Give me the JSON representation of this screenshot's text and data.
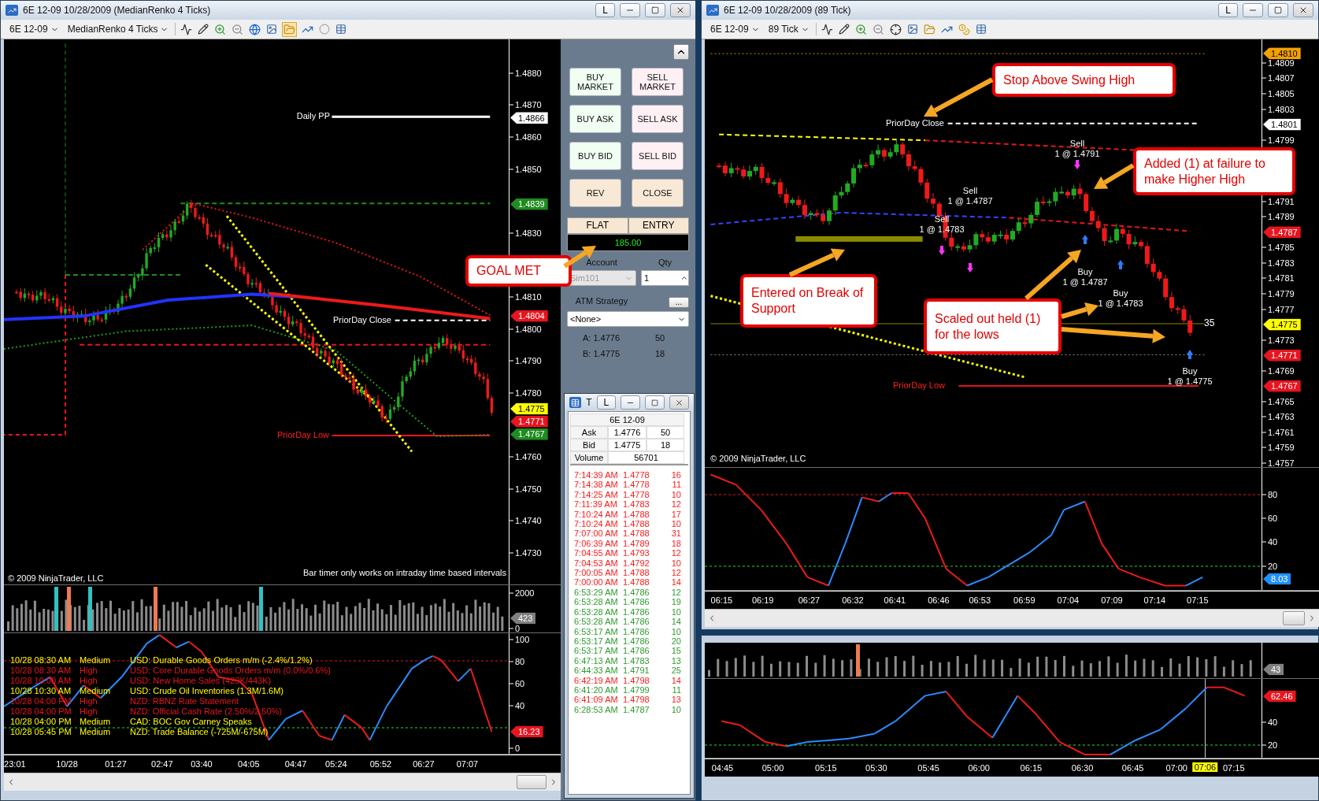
{
  "left_window": {
    "title": "6E 12-09  10/28/2009 (MedianRenko 4 Ticks)",
    "pin": "L",
    "toolbar": {
      "instrument": "6E 12-09",
      "period": "MedianRenko 4 Ticks"
    },
    "price_chart": {
      "daily_pp": "Daily PP",
      "prior_close": "PriorDay Close",
      "prior_low": "PriorDay Low",
      "copyright": "© 2009 NinjaTrader, LLC",
      "bar_timer_note": "Bar timer only works on intraday time based intervals",
      "axis": [
        "1.4880",
        "1.4870",
        "1.4860",
        "1.4850",
        "1.4830",
        "1.4810",
        "1.4800",
        "1.4790",
        "1.4780",
        "1.4760",
        "1.4750",
        "1.4740",
        "1.4730"
      ],
      "tags": [
        {
          "text": "1.4866",
          "color": "#ffffff"
        },
        {
          "text": "1.4839",
          "color": "#1e8c1e"
        },
        {
          "text": "1.4804",
          "color": "#e8141e"
        },
        {
          "text": "1.4775",
          "color": "#ffff00"
        },
        {
          "text": "1.4771",
          "color": "#e8141e"
        },
        {
          "text": "1.4767",
          "color": "#1e8c1e"
        }
      ],
      "callout": "GOAL MET"
    },
    "volume": {
      "axis": [
        "2000",
        "0"
      ],
      "tag": {
        "text": "423",
        "color": "#808080"
      }
    },
    "oscillator": {
      "axis": [
        "100",
        "80",
        "60",
        "40",
        "0"
      ],
      "tag": {
        "text": "16.23",
        "color": "#e8141e"
      },
      "news": [
        {
          "time": "10/28 08:30 AM",
          "impact": "Medium",
          "text": "USD: Durable Goods Orders m/m (-2.4%/1.2%)",
          "color": "#ffff00"
        },
        {
          "time": "10/28 08:30 AM",
          "impact": "High",
          "text": "USD: Core Durable Goods Orders m/m (0.0%/0.6%)",
          "color": "#e8141e"
        },
        {
          "time": "10/28 10:00 AM",
          "impact": "High",
          "text": "USD: New Home Sales (429K/443K)",
          "color": "#e8141e"
        },
        {
          "time": "10/28 10:30 AM",
          "impact": "Medium",
          "text": "USD: Crude Oil Inventories (1.3M/1.6M)",
          "color": "#ffff00"
        },
        {
          "time": "10/28 04:00 PM",
          "impact": "High",
          "text": "NZD: RBNZ Rate Statement",
          "color": "#e8141e"
        },
        {
          "time": "10/28 04:00 PM",
          "impact": "High",
          "text": "NZD: Official Cash Rate (2.50%/2.50%)",
          "color": "#e8141e"
        },
        {
          "time": "10/28 04:00 PM",
          "impact": "Medium",
          "text": "CAD: BOC Gov Carney Speaks",
          "color": "#ffff00"
        },
        {
          "time": "10/28 05:45 PM",
          "impact": "Medium",
          "text": "NZD: Trade Balance (-725M/-675M)",
          "color": "#ffff00"
        }
      ]
    },
    "x_axis": [
      "23:01",
      "10/28",
      "01:27",
      "02:47",
      "03:40",
      "04:05",
      "04:47",
      "05:24",
      "05:52",
      "06:27",
      "07:07"
    ]
  },
  "order_panel": {
    "buttons": [
      {
        "label": "BUY MARKET",
        "kind": "buy"
      },
      {
        "label": "SELL MARKET",
        "kind": "sell"
      },
      {
        "label": "BUY ASK",
        "kind": "buy"
      },
      {
        "label": "SELL ASK",
        "kind": "sell"
      },
      {
        "label": "BUY BID",
        "kind": "buy"
      },
      {
        "label": "SELL BID",
        "kind": "sell"
      },
      {
        "label": "REV",
        "kind": "neutral"
      },
      {
        "label": "CLOSE",
        "kind": "neutral"
      }
    ],
    "position": {
      "status": "FLAT",
      "entry": "ENTRY",
      "pnl": "185.00"
    },
    "account": {
      "label": "Account",
      "value": "Sim101",
      "disabled": true
    },
    "qty": {
      "label": "Qty",
      "value": "1"
    },
    "atm": {
      "label": "ATM Strategy",
      "button": "...",
      "value": "<None>"
    },
    "quote": [
      {
        "label": "A: 1.4776",
        "size": "50"
      },
      {
        "label": "B: 1.4775",
        "size": "18"
      }
    ]
  },
  "time_sales": {
    "title": "T",
    "pin": "L",
    "instrument": "6E 12-09",
    "quote": [
      {
        "label": "Ask",
        "price": "1.4776",
        "size": "50"
      },
      {
        "label": "Bid",
        "price": "1.4775",
        "size": "18"
      }
    ],
    "volume_label": "Volume",
    "volume": "56701",
    "trades": [
      {
        "time": "7:14:39 AM",
        "price": "1.4778",
        "size": "16",
        "color": "#ff1a1a"
      },
      {
        "time": "7:14:38 AM",
        "price": "1.4778",
        "size": "11",
        "color": "#ff1a1a"
      },
      {
        "time": "7:14:25 AM",
        "price": "1.4778",
        "size": "10",
        "color": "#ff1a1a"
      },
      {
        "time": "7:11:39 AM",
        "price": "1.4783",
        "size": "12",
        "color": "#ff1a1a"
      },
      {
        "time": "7:10:24 AM",
        "price": "1.4788",
        "size": "17",
        "color": "#ff1a1a"
      },
      {
        "time": "7:10:24 AM",
        "price": "1.4788",
        "size": "10",
        "color": "#ff1a1a"
      },
      {
        "time": "7:07:00 AM",
        "price": "1.4788",
        "size": "31",
        "color": "#ff1a1a"
      },
      {
        "time": "7:06:39 AM",
        "price": "1.4789",
        "size": "18",
        "color": "#ff1a1a"
      },
      {
        "time": "7:04:55 AM",
        "price": "1.4793",
        "size": "12",
        "color": "#ff1a1a"
      },
      {
        "time": "7:04:53 AM",
        "price": "1.4792",
        "size": "10",
        "color": "#ff1a1a"
      },
      {
        "time": "7:00:05 AM",
        "price": "1.4788",
        "size": "12",
        "color": "#ff1a1a"
      },
      {
        "time": "7:00:00 AM",
        "price": "1.4788",
        "size": "14",
        "color": "#ff1a1a"
      },
      {
        "time": "6:53:29 AM",
        "price": "1.4786",
        "size": "12",
        "color": "#2e9a2e"
      },
      {
        "time": "6:53:28 AM",
        "price": "1.4786",
        "size": "19",
        "color": "#2e9a2e"
      },
      {
        "time": "6:53:28 AM",
        "price": "1.4786",
        "size": "10",
        "color": "#2e9a2e"
      },
      {
        "time": "6:53:28 AM",
        "price": "1.4786",
        "size": "14",
        "color": "#2e9a2e"
      },
      {
        "time": "6:53:17 AM",
        "price": "1.4786",
        "size": "10",
        "color": "#2e9a2e"
      },
      {
        "time": "6:53:17 AM",
        "price": "1.4786",
        "size": "20",
        "color": "#2e9a2e"
      },
      {
        "time": "6:53:17 AM",
        "price": "1.4786",
        "size": "15",
        "color": "#2e9a2e"
      },
      {
        "time": "6:47:13 AM",
        "price": "1.4783",
        "size": "13",
        "color": "#2e9a2e"
      },
      {
        "time": "6:44:33 AM",
        "price": "1.4791",
        "size": "25",
        "color": "#2e9a2e"
      },
      {
        "time": "6:42:19 AM",
        "price": "1.4798",
        "size": "14",
        "color": "#ff1a1a"
      },
      {
        "time": "6:41:20 AM",
        "price": "1.4799",
        "size": "11",
        "color": "#2e9a2e"
      },
      {
        "time": "6:41:09 AM",
        "price": "1.4798",
        "size": "13",
        "color": "#ff1a1a"
      },
      {
        "time": "6:28:53 AM",
        "price": "1.4787",
        "size": "10",
        "color": "#2e9a2e"
      }
    ]
  },
  "right_window": {
    "title": "6E 12-09  10/28/2009 (89 Tick)",
    "pin": "L",
    "toolbar": {
      "instrument": "6E 12-09",
      "period": "89 Tick"
    },
    "price_chart": {
      "prior_close": "PriorDay Close",
      "prior_low": "PriorDay Low",
      "copyright": "© 2009 NinjaTrader, LLC",
      "count": "35",
      "axis": [
        "1.4809",
        "1.4807",
        "1.4805",
        "1.4803",
        "1.4799",
        "1.4791",
        "1.4789",
        "1.4785",
        "1.4783",
        "1.4781",
        "1.4779",
        "1.4777",
        "1.4773",
        "1.4769",
        "1.4765",
        "1.4763",
        "1.4761",
        "1.4759",
        "1.4757"
      ],
      "tags": [
        {
          "text": "1.4810",
          "color": "#f5a000"
        },
        {
          "text": "1.4801",
          "color": "#ffffff"
        },
        {
          "text": "1.4787",
          "color": "#e8141e"
        },
        {
          "text": "1.4775",
          "color": "#ffff00"
        },
        {
          "text": "1.4771",
          "color": "#e8141e"
        },
        {
          "text": "1.4767",
          "color": "#e8141e"
        }
      ],
      "trades": [
        {
          "kind": "sell",
          "side": "Sell",
          "fill": "1 @ 1.4791"
        },
        {
          "kind": "sell",
          "side": "Sell",
          "fill": "1 @ 1.4787"
        },
        {
          "kind": "sell",
          "side": "Sell",
          "fill": "1 @ 1.4783"
        },
        {
          "kind": "buy",
          "side": "Buy",
          "fill": "1 @ 1.4787"
        },
        {
          "kind": "buy",
          "side": "Buy",
          "fill": "1 @ 1.4783"
        },
        {
          "kind": "buy",
          "side": "Buy",
          "fill": "1 @ 1.4775"
        }
      ],
      "callouts": [
        "Stop Above Swing High",
        "Added (1) at failure to make Higher High",
        "Entered on Break of Support",
        "Scaled out held (1) for the lows"
      ]
    },
    "oscillator": {
      "axis": [
        "80",
        "60",
        "40",
        "20"
      ],
      "tag": {
        "text": "8.03",
        "color": "#1e90ff"
      }
    },
    "x_axis": [
      "06:15",
      "06:19",
      "06:27",
      "06:32",
      "06:41",
      "06:46",
      "06:53",
      "06:59",
      "07:04",
      "07:09",
      "07:14",
      "07:15"
    ]
  },
  "bottom_window": {
    "volume": {
      "tag": {
        "text": "43",
        "color": "#808080"
      }
    },
    "oscillator": {
      "axis": [
        "40",
        "20"
      ],
      "tag": {
        "text": "62.46",
        "color": "#e8141e"
      }
    },
    "x_axis": [
      "04:45",
      "05:00",
      "05:15",
      "05:30",
      "05:45",
      "06:00",
      "06:15",
      "06:30",
      "06:45",
      "07:00",
      "07:15"
    ],
    "cursor_label": "07:06"
  }
}
